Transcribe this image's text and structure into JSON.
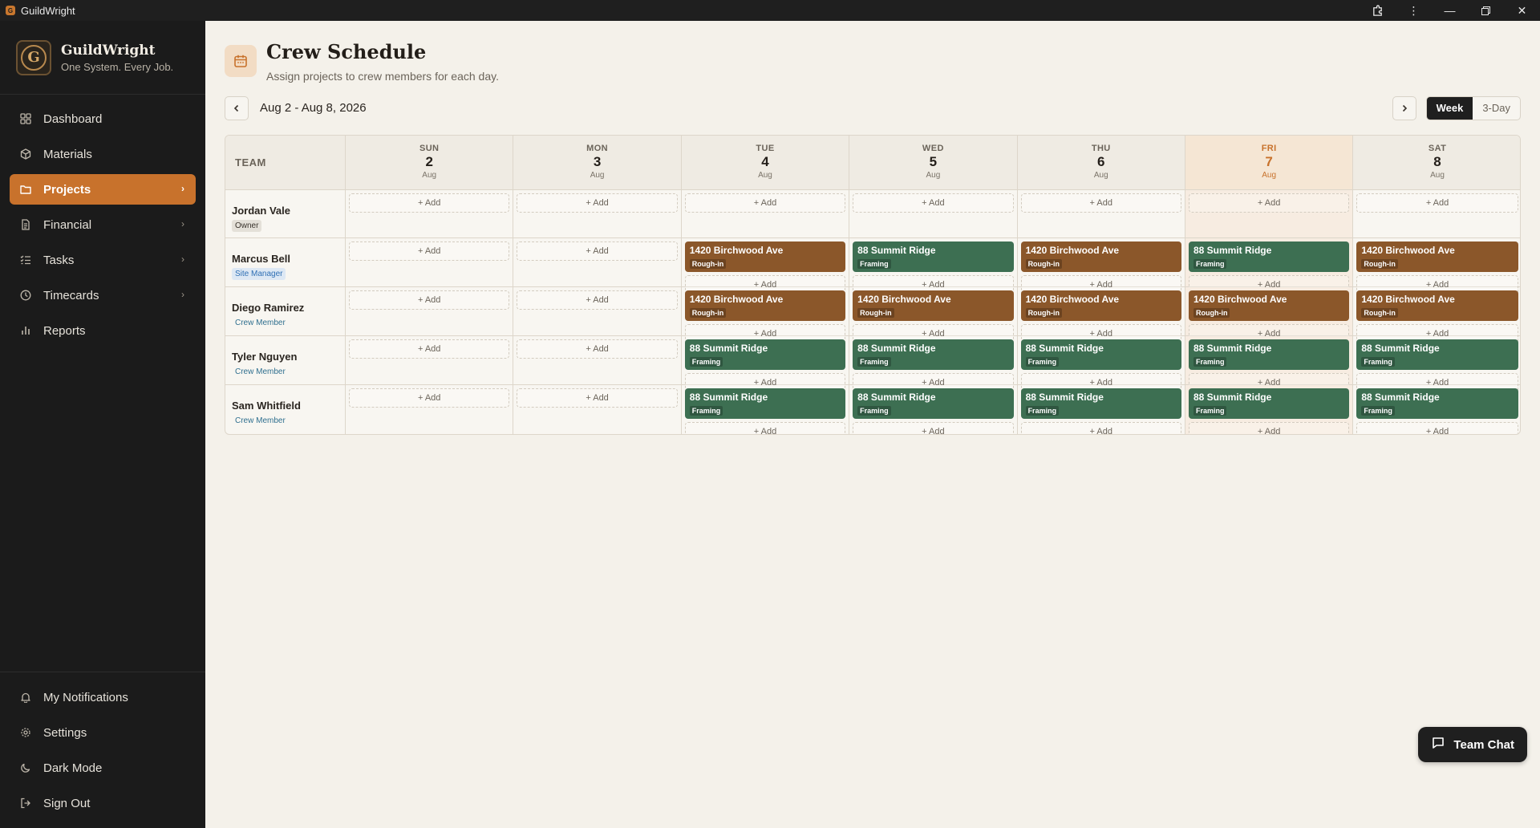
{
  "window": {
    "title": "GuildWright"
  },
  "brand": {
    "name": "GuildWright",
    "tagline": "One System. Every Job."
  },
  "nav": [
    {
      "label": "Dashboard",
      "icon": "grid-icon",
      "chevron": false,
      "active": false
    },
    {
      "label": "Materials",
      "icon": "box-icon",
      "chevron": false,
      "active": false
    },
    {
      "label": "Projects",
      "icon": "folder-icon",
      "chevron": true,
      "active": true
    },
    {
      "label": "Financial",
      "icon": "document-icon",
      "chevron": true,
      "active": false
    },
    {
      "label": "Tasks",
      "icon": "checklist-icon",
      "chevron": true,
      "active": false
    },
    {
      "label": "Timecards",
      "icon": "clock-icon",
      "chevron": true,
      "active": false
    },
    {
      "label": "Reports",
      "icon": "bar-chart-icon",
      "chevron": false,
      "active": false
    }
  ],
  "nav_bottom": [
    {
      "label": "My Notifications",
      "icon": "bell-icon"
    },
    {
      "label": "Settings",
      "icon": "gear-icon"
    },
    {
      "label": "Dark Mode",
      "icon": "moon-icon"
    },
    {
      "label": "Sign Out",
      "icon": "sign-out-icon"
    }
  ],
  "page": {
    "title": "Crew Schedule",
    "subtitle": "Assign projects to crew members for each day.",
    "date_range": "Aug 2 - Aug 8, 2026"
  },
  "view_toggle": {
    "week": "Week",
    "three_day": "3-Day",
    "selected": "Week"
  },
  "grid": {
    "team_header": "TEAM",
    "add_label": "+ Add",
    "days": [
      {
        "dow": "SUN",
        "num": "2",
        "mon": "Aug",
        "today": false
      },
      {
        "dow": "MON",
        "num": "3",
        "mon": "Aug",
        "today": false
      },
      {
        "dow": "TUE",
        "num": "4",
        "mon": "Aug",
        "today": false
      },
      {
        "dow": "WED",
        "num": "5",
        "mon": "Aug",
        "today": false
      },
      {
        "dow": "THU",
        "num": "6",
        "mon": "Aug",
        "today": false
      },
      {
        "dow": "FRI",
        "num": "7",
        "mon": "Aug",
        "today": true
      },
      {
        "dow": "SAT",
        "num": "8",
        "mon": "Aug",
        "today": false
      }
    ],
    "members": [
      {
        "name": "Jordan Vale",
        "role": "Owner",
        "role_style": "owner",
        "assignments": [
          [],
          [],
          [],
          [],
          [],
          [],
          []
        ]
      },
      {
        "name": "Marcus Bell",
        "role": "Site Manager",
        "role_style": "manager",
        "assignments": [
          [],
          [],
          [
            {
              "project": "1420 Birchwood Ave",
              "phase": "Rough-in",
              "color": "brown"
            }
          ],
          [
            {
              "project": "88 Summit Ridge",
              "phase": "Framing",
              "color": "green"
            }
          ],
          [
            {
              "project": "1420 Birchwood Ave",
              "phase": "Rough-in",
              "color": "brown"
            }
          ],
          [
            {
              "project": "88 Summit Ridge",
              "phase": "Framing",
              "color": "green"
            }
          ],
          [
            {
              "project": "1420 Birchwood Ave",
              "phase": "Rough-in",
              "color": "brown"
            }
          ]
        ]
      },
      {
        "name": "Diego Ramirez",
        "role": "Crew Member",
        "role_style": "crew",
        "assignments": [
          [],
          [],
          [
            {
              "project": "1420 Birchwood Ave",
              "phase": "Rough-in",
              "color": "brown"
            }
          ],
          [
            {
              "project": "1420 Birchwood Ave",
              "phase": "Rough-in",
              "color": "brown"
            }
          ],
          [
            {
              "project": "1420 Birchwood Ave",
              "phase": "Rough-in",
              "color": "brown"
            }
          ],
          [
            {
              "project": "1420 Birchwood Ave",
              "phase": "Rough-in",
              "color": "brown"
            }
          ],
          [
            {
              "project": "1420 Birchwood Ave",
              "phase": "Rough-in",
              "color": "brown"
            }
          ]
        ]
      },
      {
        "name": "Tyler Nguyen",
        "role": "Crew Member",
        "role_style": "crew",
        "assignments": [
          [],
          [],
          [
            {
              "project": "88 Summit Ridge",
              "phase": "Framing",
              "color": "green"
            }
          ],
          [
            {
              "project": "88 Summit Ridge",
              "phase": "Framing",
              "color": "green"
            }
          ],
          [
            {
              "project": "88 Summit Ridge",
              "phase": "Framing",
              "color": "green"
            }
          ],
          [
            {
              "project": "88 Summit Ridge",
              "phase": "Framing",
              "color": "green"
            }
          ],
          [
            {
              "project": "88 Summit Ridge",
              "phase": "Framing",
              "color": "green"
            }
          ]
        ]
      },
      {
        "name": "Sam Whitfield",
        "role": "Crew Member",
        "role_style": "crew",
        "assignments": [
          [],
          [],
          [
            {
              "project": "88 Summit Ridge",
              "phase": "Framing",
              "color": "green"
            }
          ],
          [
            {
              "project": "88 Summit Ridge",
              "phase": "Framing",
              "color": "green"
            }
          ],
          [
            {
              "project": "88 Summit Ridge",
              "phase": "Framing",
              "color": "green"
            }
          ],
          [
            {
              "project": "88 Summit Ridge",
              "phase": "Framing",
              "color": "green"
            }
          ],
          [
            {
              "project": "88 Summit Ridge",
              "phase": "Framing",
              "color": "green"
            }
          ]
        ]
      }
    ]
  },
  "chat": {
    "label": "Team Chat"
  },
  "colors": {
    "accent": "#c8722c",
    "brown_card": "#8b572a",
    "green_card": "#3d6f52",
    "sidebar": "#1b1b1b"
  }
}
